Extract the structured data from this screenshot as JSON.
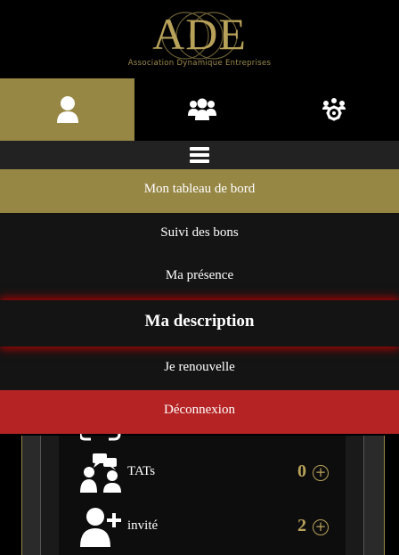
{
  "header": {
    "logo_text": "ADE",
    "logo_subtitle": "Association Dynamique Entreprises"
  },
  "tabs": [
    {
      "icon": "user-icon",
      "active": true
    },
    {
      "icon": "users-group-icon",
      "active": false
    },
    {
      "icon": "network-gear-icon",
      "active": false
    }
  ],
  "menu": {
    "toggle_icon": "hamburger-icon",
    "items": [
      {
        "label": "Mon tableau de bord"
      },
      {
        "label": "Suivi des bons"
      },
      {
        "label": "Ma présence"
      },
      {
        "label": "Ma description"
      },
      {
        "label": "Je renouvelle"
      },
      {
        "label": "Déconnexion"
      }
    ]
  },
  "dashboard": {
    "rows": [
      {
        "icon": "chat-users-icon",
        "label": "TATs",
        "count": "0"
      },
      {
        "icon": "add-user-icon",
        "label": "invité",
        "count": "2"
      }
    ],
    "plus_glyph": "+"
  },
  "colors": {
    "gold": "#978745",
    "gold_text": "#b8a25a",
    "danger": "#b52324",
    "menu_bg": "#141414"
  }
}
